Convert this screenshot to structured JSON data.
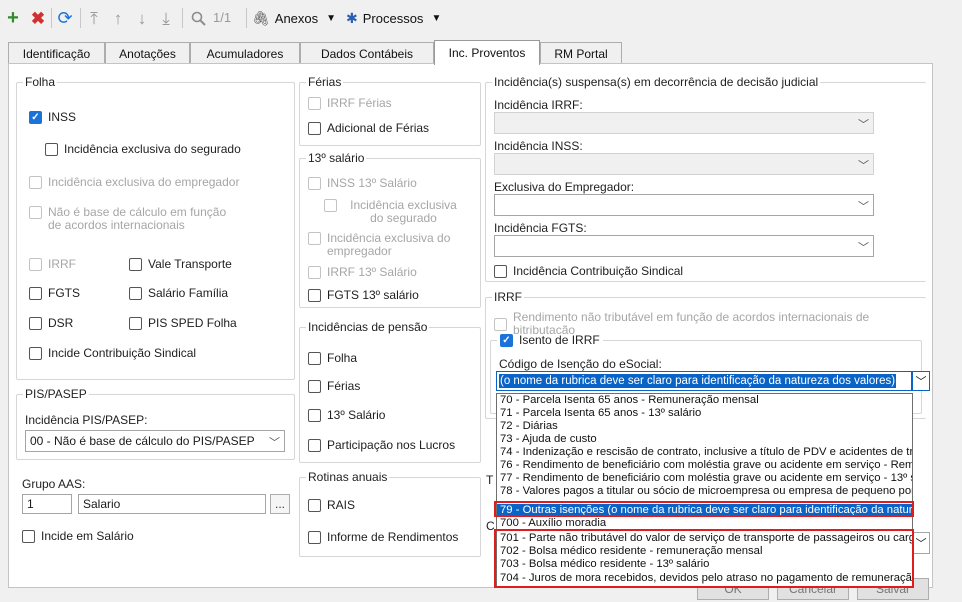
{
  "toolbar": {
    "add_icon": "plus-icon",
    "delete_icon": "x-icon",
    "refresh_icon": "refresh-icon",
    "page_counter": "1/1",
    "anexos_label": "Anexos",
    "processos_label": "Processos",
    "colors": {
      "add": "#2e8b2e",
      "delete": "#d03030",
      "accent": "#1a73d9"
    }
  },
  "tabs": [
    "Identificação",
    "Anotações",
    "Acumuladores",
    "Dados Contábeis",
    "Inc. Proventos",
    "RM Portal"
  ],
  "active_tab": "Inc. Proventos",
  "folha": {
    "title": "Folha",
    "inss": "INSS",
    "inss_checked": true,
    "inc_excl_segurado": "Incidência exclusiva do segurado",
    "inc_excl_empregador": "Incidência exclusiva do empregador",
    "nao_base": "Não é base de cálculo em função de acordos internacionais",
    "irrf": "IRRF",
    "vale_transporte": "Vale Transporte",
    "fgts": "FGTS",
    "salario_familia": "Salário Família",
    "dsr": "DSR",
    "pis_sped": "PIS SPED Folha",
    "incide_sindical": "Incide Contribuição Sindical"
  },
  "pispasep": {
    "title": "PIS/PASEP",
    "label": "Incidência PIS/PASEP:",
    "value": "00 - Não é base de cálculo do PIS/PASEP"
  },
  "grupo_aas": {
    "label": "Grupo AAS:",
    "code": "1",
    "name": "Salario",
    "browse": "...",
    "incide_salario": "Incide em Salário"
  },
  "ferias": {
    "title": "Férias",
    "irrf_ferias": "IRRF Férias",
    "adicional": "Adicional de Férias"
  },
  "decimo": {
    "title": "13º salário",
    "inss13": "INSS 13º Salário",
    "excl_seg": "Incidência exclusiva do segurado",
    "excl_emp": "Incidência exclusiva do empregador",
    "irrf13": "IRRF 13º Salário",
    "fgts13": "FGTS 13º salário"
  },
  "pensao": {
    "title": "Incidências de pensão",
    "folha": "Folha",
    "ferias": "Férias",
    "decimo": "13º Salário",
    "lucros": "Participação nos Lucros"
  },
  "rotinas": {
    "title": "Rotinas anuais",
    "rais": "RAIS",
    "informe": "Informe de Rendimentos"
  },
  "suspensa": {
    "title": "Incidência(s) suspensa(s) em decorrência de decisão judicial",
    "irrf": "Incidência IRRF:",
    "inss": "Incidência INSS:",
    "excl_emp": "Exclusiva do Empregador:",
    "fgts": "Incidência FGTS:",
    "sindical": "Incidência Contribuição Sindical"
  },
  "irrf_group": {
    "title": "IRRF",
    "rendimento": "Rendimento não tributável em função de acordos internacionais de bitributação",
    "isento": "Isento de IRRF",
    "isento_checked": true,
    "codigo_label": "Código de Isenção do eSocial:",
    "codigo_value": "(o nome da rubrica deve ser claro para identificação da natureza dos valores)"
  },
  "dropdown_options": [
    "70 - Parcela Isenta 65 anos - Remuneração mensal",
    "71 - Parcela Isenta 65 anos - 13º salário",
    "72 - Diárias",
    "73 - Ajuda de custo",
    "74 - Indenização e rescisão de contrato, inclusive a título de PDV e acidentes de tr",
    "76 - Rendimento de beneficiário com moléstia grave ou acidente em serviço - Rem",
    "77 - Rendimento de beneficiário com moléstia grave ou acidente em serviço - 13º s",
    "78 - Valores pagos a titular ou sócio de microempresa ou empresa de pequeno por",
    "79 - Outras isenções (o nome da rubrica deve ser claro para identificação da natur",
    "700 - Auxílio moradia",
    "701 - Parte não tributável do valor de serviço de transporte de passageiros ou carg",
    "702 - Bolsa médico residente - remuneração mensal",
    "703 - Bolsa médico residente - 13º salário",
    "704 - Juros de mora recebidos, devidos pelo atraso no pagamento de remuneraçã"
  ],
  "selected_option_index": 8,
  "partial": {
    "t_letter": "T",
    "c_letter": "C"
  },
  "buttons": {
    "ok": "OK",
    "cancel": "Cancelar",
    "save": "Salvar"
  }
}
